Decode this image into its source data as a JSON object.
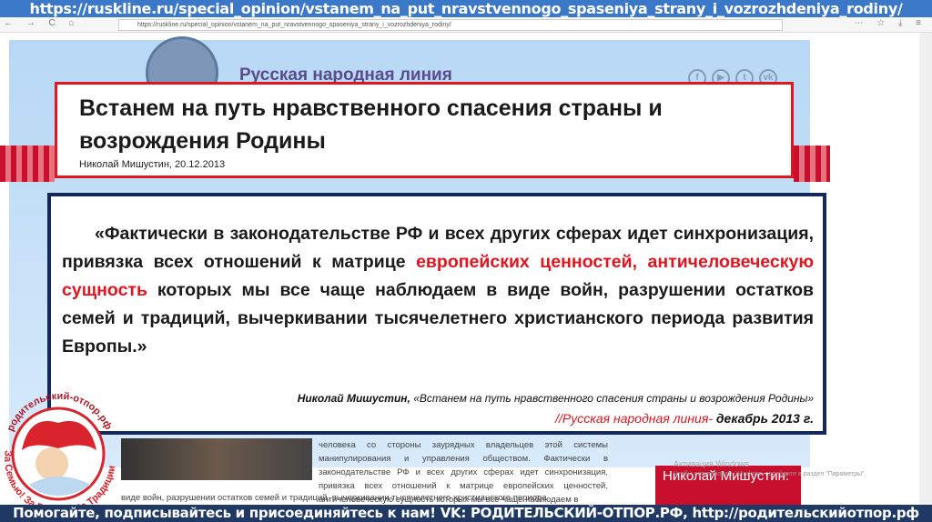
{
  "banner_url": "https://ruskline.ru/special_opinion/vstanem_na_put_nravstvennogo_spaseniya_strany_i_vozrozhdeniya_rodiny/",
  "browser": {
    "address": "https://ruskline.ru/special_opinion/vstanem_na_put_nravstvennogo_spaseniya_strany_i_vozrozhdeniya_rodiny/",
    "nav_icons": "← → C ⌂",
    "tool_icons": "⋯ ☆ ⤓ ≡"
  },
  "site": {
    "name": "Русская народная линия",
    "social": [
      "f",
      "▶",
      "t",
      "vk"
    ]
  },
  "title": {
    "heading": "Встанем на путь нравственного спасения страны и возрождения Родины",
    "meta": "Николай Мишустин, 20.12.2013"
  },
  "quote": {
    "part1": "«Фактически в законодательстве РФ и всех других сферах идет синхронизация, привязка всех отношений к матрице ",
    "highlight": "европейских ценностей, античеловеческую сущность",
    "part2": " которых мы все чаще наблюдаем в виде войн, разрушении остатков семей и традиций, вычеркивании тысячелетнего христианского периода развития Европы.»",
    "author": "Николай Мишустин,",
    "work": " «Встанем на путь нравственного спасения страны и возрождения Родины»",
    "source": "//Русская народная линия-",
    "date": " декабрь 2013 г."
  },
  "article": {
    "text": "человека со стороны заурядных владельцев этой системы манипулирования и управления обществом. Фактически в законодательстве РФ и всех других сферах идет синхронизация, привязка всех отношений к матрице европейских ценностей, античеловеческую сущность которых мы все чаще наблюдаем в",
    "text2": "виде войн, разрушении остатков семей и традиций, вычеркивании тысячелетнего христианского периода",
    "card": "Николай Мишустин:"
  },
  "windows": {
    "title": "Активация Windows",
    "hint": "Чтобы активировать Windows, перейдите в раздел \"Параметры\"."
  },
  "logo": {
    "top": "родительский-отпор.рф",
    "bottom": "За Семью! За Родину! За Традиции!"
  },
  "footer": "Помогайте, подписывайтесь и присоединяйтесь к нам! VK: РОДИТЕЛЬСКИЙ-ОТПОР.РФ, http://родительскийотпор.рф"
}
